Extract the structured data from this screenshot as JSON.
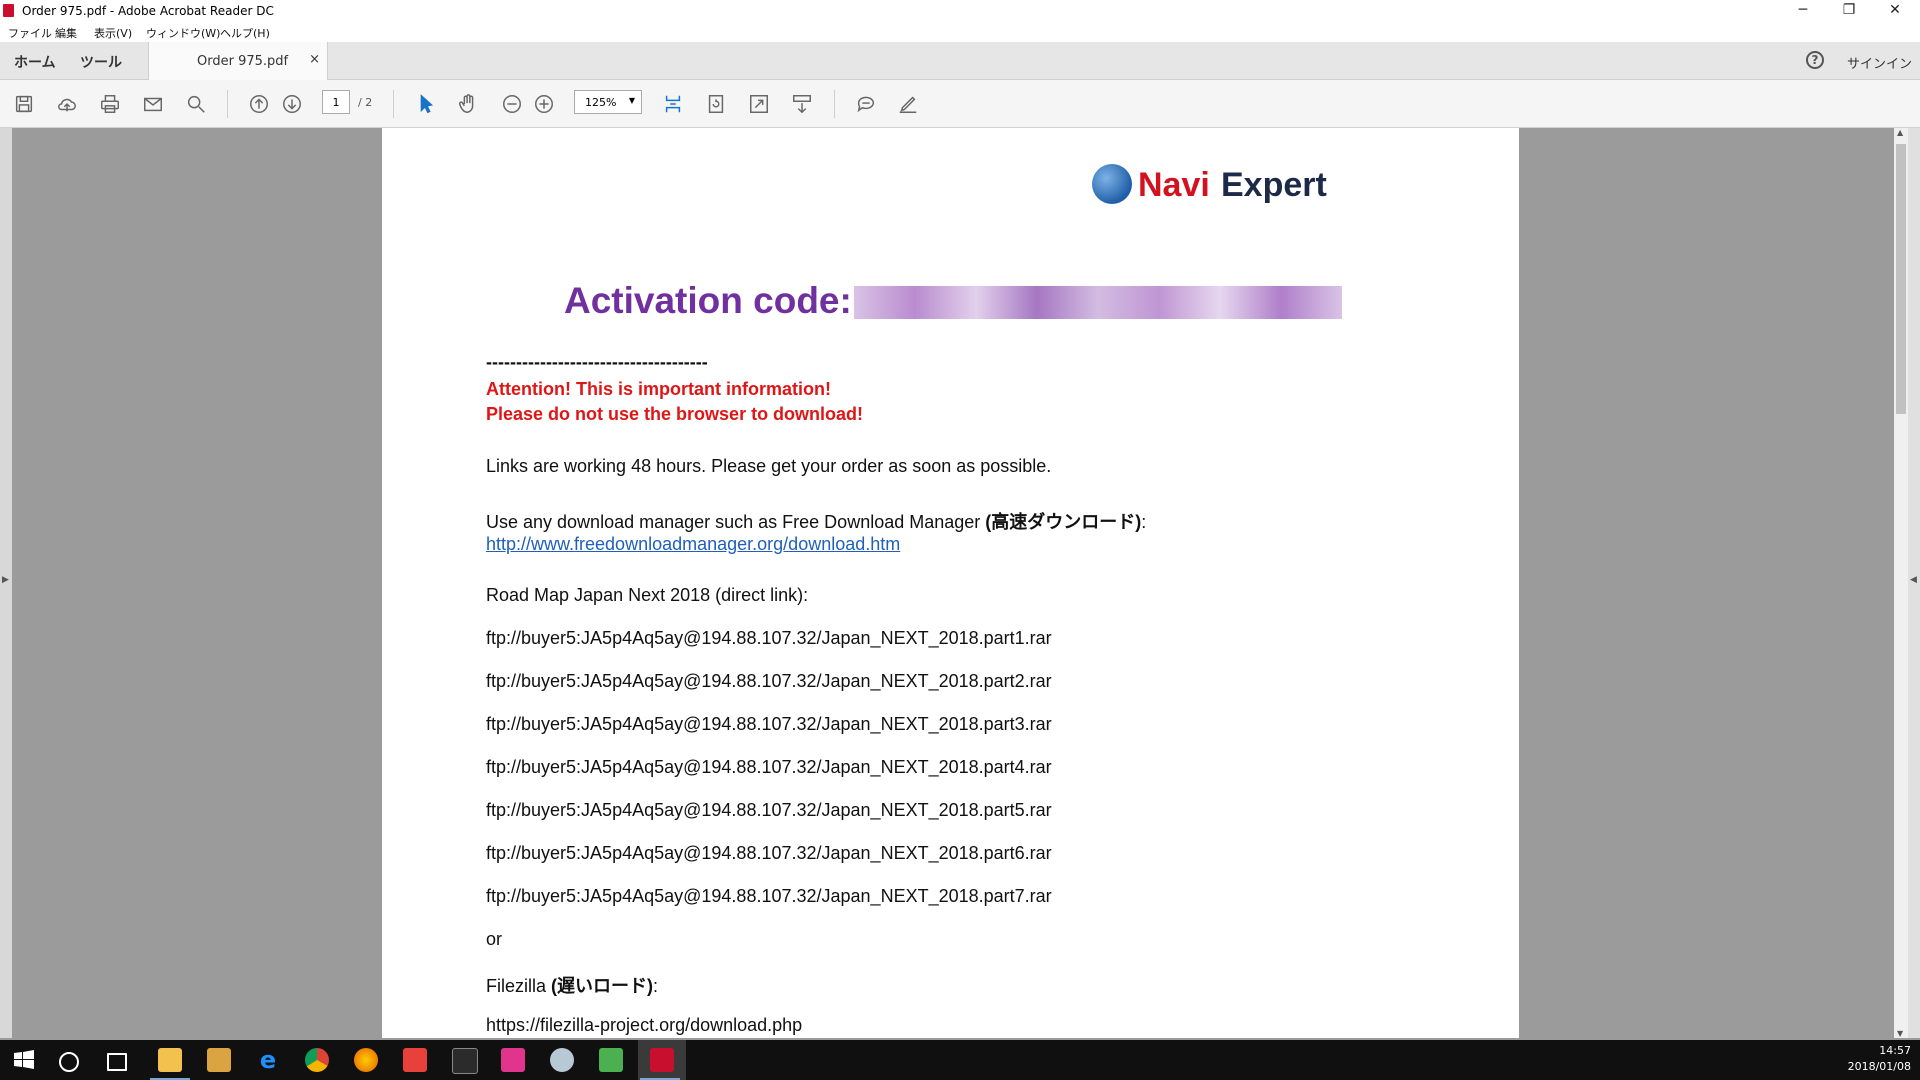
{
  "window": {
    "title": "Order 975.pdf - Adobe Acrobat Reader DC",
    "minimize": "─",
    "maximize": "❐",
    "close": "✕"
  },
  "menu": [
    "ファイル",
    "編集",
    "表示(V)",
    "ウィンドウ(W)",
    "ヘルプ(H)"
  ],
  "tabs": {
    "home": "ホーム",
    "tools": "ツール",
    "document": "Order 975.pdf",
    "close": "×",
    "help": "?",
    "signin": "サインイン"
  },
  "toolbar": {
    "page_current": "1",
    "page_total": "/ 2",
    "zoom": "125%"
  },
  "document": {
    "logo_navi": "Navi",
    "logo_expert": "Expert",
    "activation_label": "Activation code:",
    "dashes": "-------------------------------------",
    "attention": "Attention! This is important information!",
    "no_browser": "Please do not use the browser to download!",
    "links_working": "Links are working 48 hours. Please get your order as soon as possible.",
    "use_manager_prefix": "Use any download manager such as Free Download Manager ",
    "use_manager_jp": "(高速ダウンロード)",
    "use_manager_suffix": ":",
    "fdm_link": "http://www.freedownloadmanager.org/download.htm",
    "direct_link_title": "Road Map Japan Next 2018 (direct link):",
    "parts": [
      "ftp://buyer5:JA5p4Aq5ay@194.88.107.32/Japan_NEXT_2018.part1.rar",
      "ftp://buyer5:JA5p4Aq5ay@194.88.107.32/Japan_NEXT_2018.part2.rar",
      "ftp://buyer5:JA5p4Aq5ay@194.88.107.32/Japan_NEXT_2018.part3.rar",
      "ftp://buyer5:JA5p4Aq5ay@194.88.107.32/Japan_NEXT_2018.part4.rar",
      "ftp://buyer5:JA5p4Aq5ay@194.88.107.32/Japan_NEXT_2018.part5.rar",
      "ftp://buyer5:JA5p4Aq5ay@194.88.107.32/Japan_NEXT_2018.part6.rar",
      "ftp://buyer5:JA5p4Aq5ay@194.88.107.32/Japan_NEXT_2018.part7.rar"
    ],
    "or": "or",
    "filezilla_prefix": "Filezilla ",
    "filezilla_jp": "(遅いロード)",
    "filezilla_suffix": ":",
    "filezilla_link": "https://filezilla-project.org/download.php"
  },
  "taskbar": {
    "time": "14:57",
    "date": "2018/01/08"
  },
  "colors": {
    "attention_red": "#e01616",
    "activation_purple": "#7030a0",
    "link_blue": "#1f5fbf",
    "navi_red": "#d3121f"
  }
}
